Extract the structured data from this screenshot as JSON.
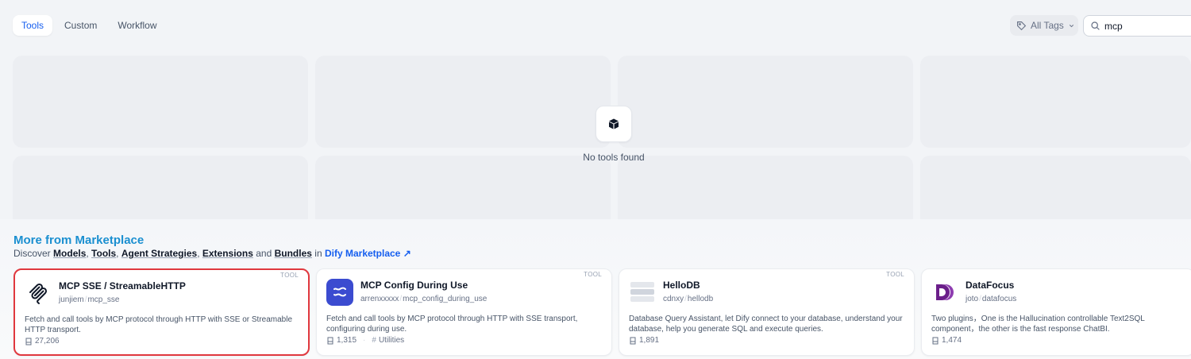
{
  "tabs": [
    {
      "label": "Tools",
      "active": true
    },
    {
      "label": "Custom",
      "active": false
    },
    {
      "label": "Workflow",
      "active": false
    }
  ],
  "tag_filter": {
    "label": "All Tags",
    "icon": "tag-icon"
  },
  "search": {
    "value": "mcp",
    "icon": "search-icon"
  },
  "empty_state": {
    "icon": "cube-icon",
    "text": "No tools found"
  },
  "marketplace": {
    "title": "More from Marketplace",
    "subtitle": {
      "prefix": "Discover",
      "models": "Models",
      "tools": "Tools",
      "agent_strategies": "Agent Strategies",
      "extensions": "Extensions",
      "and": "and",
      "bundles": "Bundles",
      "in": "in",
      "link": "Dify Marketplace ↗"
    },
    "cards": [
      {
        "name": "MCP SSE / StreamableHTTP",
        "org": "junjiem",
        "plugin": "mcp_sse",
        "badge": "TOOL",
        "description": "Fetch and call tools by MCP protocol through HTTP with SSE or Streamable HTTP transport.",
        "installs": "27,206",
        "tag": "",
        "icon": "mcp-logo-icon"
      },
      {
        "name": "MCP Config During Use",
        "org": "arrenxxxxx",
        "plugin": "mcp_config_during_use",
        "badge": "TOOL",
        "description": "Fetch and call tools by MCP protocol through HTTP with SSE transport, configuring during use.",
        "installs": "1,315",
        "tag": "Utilities",
        "icon": "wave-logo-icon"
      },
      {
        "name": "HelloDB",
        "org": "cdnxy",
        "plugin": "hellodb",
        "badge": "TOOL",
        "description": "Database Query Assistant, let Dify connect to your database, understand your database, help you generate SQL and execute queries.",
        "installs": "1,891",
        "tag": "",
        "icon": "database-icon"
      },
      {
        "name": "DataFocus",
        "org": "joto",
        "plugin": "datafocus",
        "badge": "",
        "description": "Two plugins，One is the Hallucination controllable Text2SQL component，the other is the fast response ChatBI.",
        "installs": "1,474",
        "tag": "",
        "icon": "datafocus-logo-icon"
      }
    ]
  },
  "colors": {
    "accent": "#155eef",
    "marketplace_title": "#1a8fd0",
    "selection": "#e0383e"
  }
}
